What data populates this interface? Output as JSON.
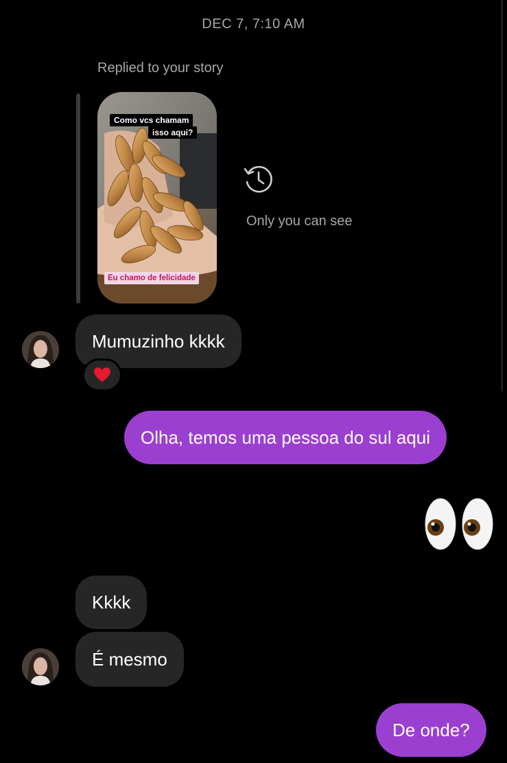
{
  "thread": {
    "timestamp": "DEC 7, 7:10 AM"
  },
  "story_reply": {
    "label": "Replied to your story",
    "story_caption_line1": "Como vcs chamam",
    "story_caption_line2": "isso aqui?",
    "story_bottom_caption": "Eu chamo de felicidade",
    "expired_icon": "history-icon",
    "expired_note": "Only you can see"
  },
  "messages": [
    {
      "side": "incoming",
      "text": "Mumuzinho kkkk",
      "reaction": "heart",
      "reaction_color": "#e8192c"
    },
    {
      "side": "outgoing",
      "text": "Olha, temos uma pessoa  do sul aqui"
    },
    {
      "side": "outgoing",
      "emoji": "eyes"
    },
    {
      "side": "incoming",
      "text": "Kkkk"
    },
    {
      "side": "incoming",
      "text": "É mesmo"
    },
    {
      "side": "outgoing",
      "text": "De onde?"
    }
  ],
  "colors": {
    "background": "#000000",
    "incoming_bubble": "#262626",
    "outgoing_bubble": "#9b3fd0",
    "meta_text": "#a8a8a8"
  }
}
